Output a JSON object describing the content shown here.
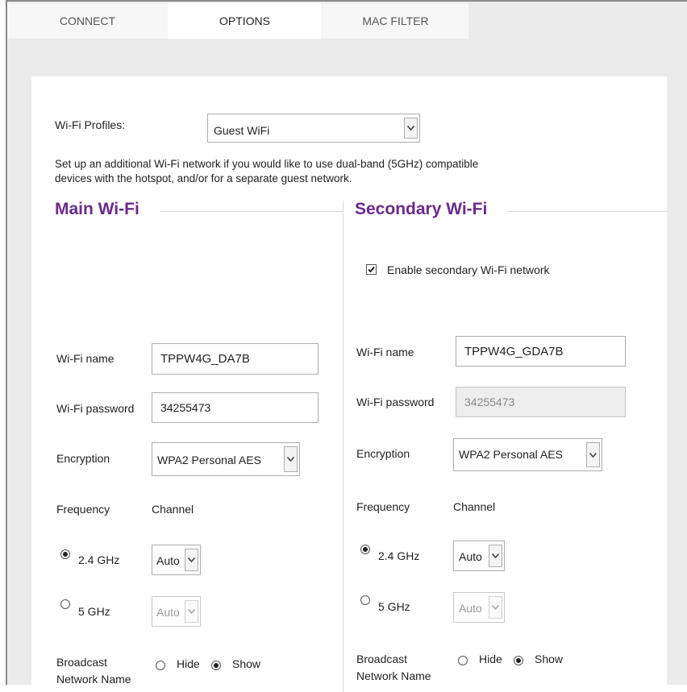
{
  "tabs": [
    "CONNECT",
    "OPTIONS",
    "MAC FILTER"
  ],
  "profiles": {
    "label": "Wi-Fi Profiles:",
    "value": "Guest WiFi"
  },
  "description": [
    "Set up an additional Wi-Fi network if you would like to use dual-band (5GHz) compatible",
    "devices with the hotspot, and/or for a separate guest network."
  ],
  "main": {
    "title": "Main Wi-Fi",
    "wifi_name_label": "Wi-Fi name",
    "wifi_name_value": "TPPW4G_DA7B",
    "password_label": "Wi-Fi password",
    "password_value": "34255473",
    "encryption_label": "Encryption",
    "encryption_value": "WPA2 Personal AES",
    "frequency_label": "Frequency",
    "channel_label": "Channel",
    "band1_label": "2.4 GHz",
    "band1_channel": "Auto",
    "band2_label": "5 GHz",
    "band2_channel": "Auto",
    "broadcast_label_1": "Broadcast",
    "broadcast_label_2": "Network Name",
    "hide_label": "Hide",
    "show_label": "Show"
  },
  "secondary": {
    "title": "Secondary Wi-Fi",
    "enable_label": "Enable secondary Wi-Fi network",
    "enable_checked": true,
    "wifi_name_label": "Wi-Fi name",
    "wifi_name_value": "TPPW4G_GDA7B",
    "password_label": "Wi-Fi password",
    "password_value": "34255473",
    "encryption_label": "Encryption",
    "encryption_value": "WPA2 Personal AES",
    "frequency_label": "Frequency",
    "channel_label": "Channel",
    "band1_label": "2.4 GHz",
    "band1_channel": "Auto",
    "band2_label": "5 GHz",
    "band2_channel": "Auto",
    "broadcast_label_1": "Broadcast",
    "broadcast_label_2": "Network Name",
    "hide_label": "Hide",
    "show_label": "Show"
  },
  "colors": {
    "heading": "#6c2a8a"
  }
}
